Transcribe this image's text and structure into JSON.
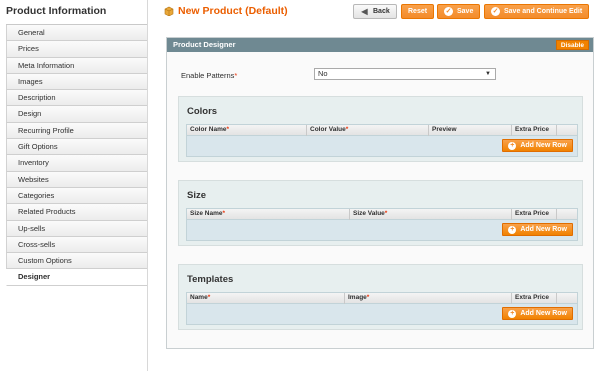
{
  "sidebar": {
    "title": "Product Information",
    "items": [
      {
        "label": "General"
      },
      {
        "label": "Prices"
      },
      {
        "label": "Meta Information"
      },
      {
        "label": "Images"
      },
      {
        "label": "Description"
      },
      {
        "label": "Design"
      },
      {
        "label": "Recurring Profile"
      },
      {
        "label": "Gift Options"
      },
      {
        "label": "Inventory"
      },
      {
        "label": "Websites"
      },
      {
        "label": "Categories"
      },
      {
        "label": "Related Products"
      },
      {
        "label": "Up-sells"
      },
      {
        "label": "Cross-sells"
      },
      {
        "label": "Custom Options"
      },
      {
        "label": "Designer"
      }
    ],
    "active": "Designer"
  },
  "header": {
    "title": "New Product (Default)",
    "buttons": {
      "back": "Back",
      "reset": "Reset",
      "save": "Save",
      "save_continue": "Save and Continue Edit"
    }
  },
  "panel": {
    "title": "Product Designer",
    "disable": "Disable",
    "enable_patterns": {
      "label": "Enable Patterns",
      "required_mark": "*",
      "value": "No"
    },
    "sections": [
      {
        "title": "Colors",
        "columns": [
          {
            "label": "Color Name",
            "required": "*"
          },
          {
            "label": "Color Value",
            "required": "*"
          },
          {
            "label": "Preview",
            "required": ""
          },
          {
            "label": "Extra Price",
            "required": ""
          }
        ],
        "add_label": "Add New Row"
      },
      {
        "title": "Size",
        "columns": [
          {
            "label": "Size Name",
            "required": "*"
          },
          {
            "label": "Size Value",
            "required": "*"
          },
          {
            "label": "Extra Price",
            "required": ""
          }
        ],
        "add_label": "Add New Row"
      },
      {
        "title": "Templates",
        "columns": [
          {
            "label": "Name",
            "required": "*"
          },
          {
            "label": "Image",
            "required": "*"
          },
          {
            "label": "Extra Price",
            "required": ""
          }
        ],
        "add_label": "Add New Row"
      }
    ]
  },
  "colors": {
    "accent": "#eb5e00",
    "button_orange": "#f18b2b",
    "panel_header": "#6f8992"
  }
}
